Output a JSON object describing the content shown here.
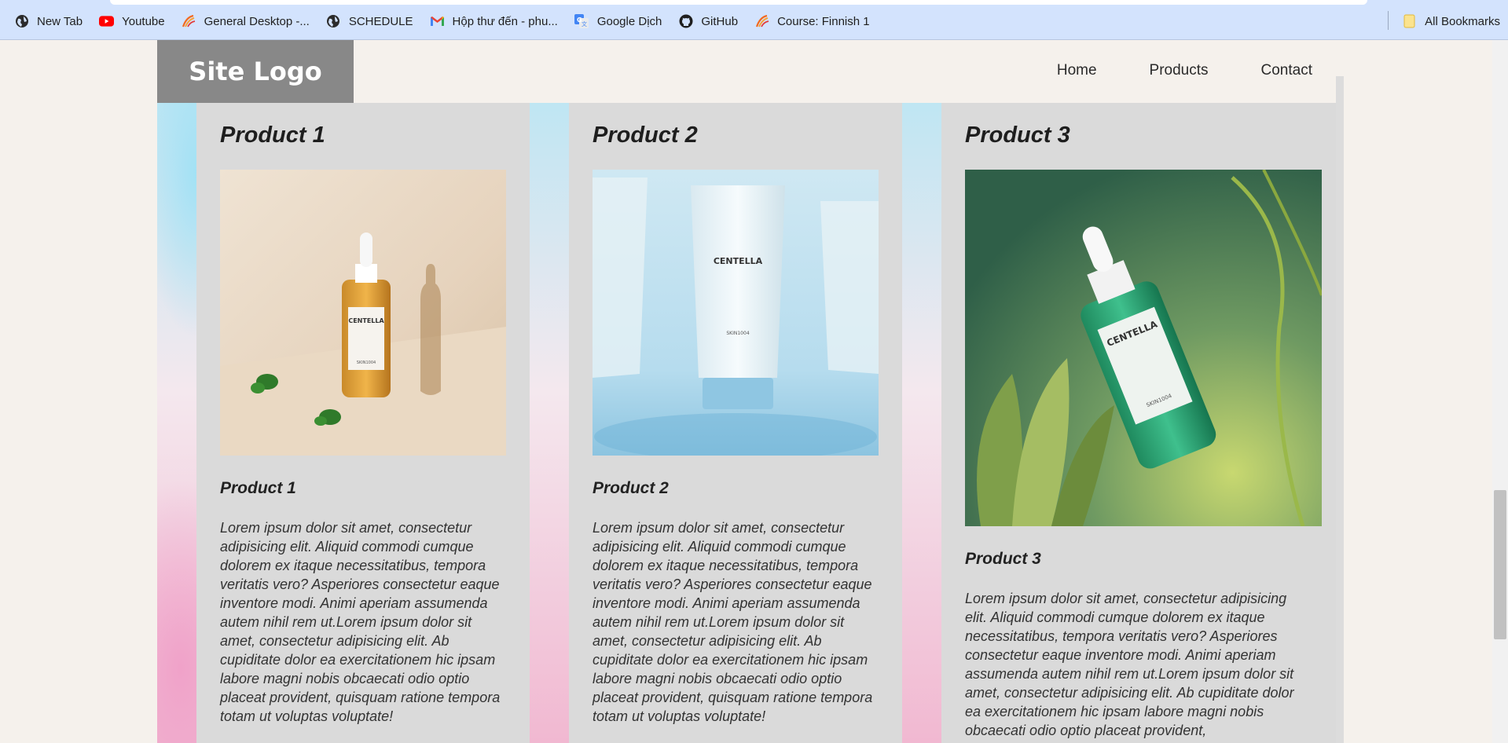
{
  "bookmarks": {
    "items": [
      {
        "label": "New Tab",
        "icon": "globe-icon"
      },
      {
        "label": "Youtube",
        "icon": "youtube-icon"
      },
      {
        "label": "General Desktop -...",
        "icon": "course-icon"
      },
      {
        "label": "SCHEDULE",
        "icon": "globe-icon"
      },
      {
        "label": "Hộp thư đến - phu...",
        "icon": "gmail-icon"
      },
      {
        "label": "Google Dịch",
        "icon": "translate-icon"
      },
      {
        "label": "GitHub",
        "icon": "github-icon"
      },
      {
        "label": "Course: Finnish 1",
        "icon": "course-icon"
      }
    ],
    "all_bookmarks": {
      "label": "All Bookmarks",
      "icon": "folder-icon"
    }
  },
  "header": {
    "logo": "Site Logo",
    "nav": [
      "Home",
      "Products",
      "Contact"
    ]
  },
  "products": [
    {
      "title": "Product 1",
      "subtitle": "Product 1",
      "image": "amber-serum-bottle-photo",
      "description": "Lorem ipsum dolor sit amet, consectetur adipisicing elit. Aliquid commodi cumque dolorem ex itaque necessitatibus, tempora veritatis vero? Asperiores consectetur eaque inventore modi. Animi aperiam assumenda autem nihil rem ut.Lorem ipsum dolor sit amet, consectetur adipisicing elit. Ab cupiditate dolor ea exercitationem hic ipsam labore magni nobis obcaecati odio optio placeat provident, quisquam ratione tempora totam ut voluptas voluptate!"
    },
    {
      "title": "Product 2",
      "subtitle": "Product 2",
      "image": "blue-tube-cream-photo",
      "description": "Lorem ipsum dolor sit amet, consectetur adipisicing elit. Aliquid commodi cumque dolorem ex itaque necessitatibus, tempora veritatis vero? Asperiores consectetur eaque inventore modi. Animi aperiam assumenda autem nihil rem ut.Lorem ipsum dolor sit amet, consectetur adipisicing elit. Ab cupiditate dolor ea exercitationem hic ipsam labore magni nobis obcaecati odio optio placeat provident, quisquam ratione tempora totam ut voluptas voluptate!"
    },
    {
      "title": "Product 3",
      "subtitle": "Product 3",
      "image": "green-ampoule-bottle-photo",
      "description": "Lorem ipsum dolor sit amet, consectetur adipisicing elit. Aliquid commodi cumque dolorem ex itaque necessitatibus, tempora veritatis vero? Asperiores consectetur eaque inventore modi. Animi aperiam assumenda autem nihil rem ut.Lorem ipsum dolor sit amet, consectetur adipisicing elit. Ab cupiditate dolor ea exercitationem hic ipsam labore magni nobis obcaecati odio optio placeat provident,"
    }
  ],
  "bottle_labels": {
    "brand": "CENTELLA",
    "maker": "SKIN1004"
  },
  "colors": {
    "logo_bg": "#888888",
    "card_bg": "#dadada",
    "page_bg": "#f5f1ec",
    "bookmarks_bg": "#d3e3fd"
  }
}
